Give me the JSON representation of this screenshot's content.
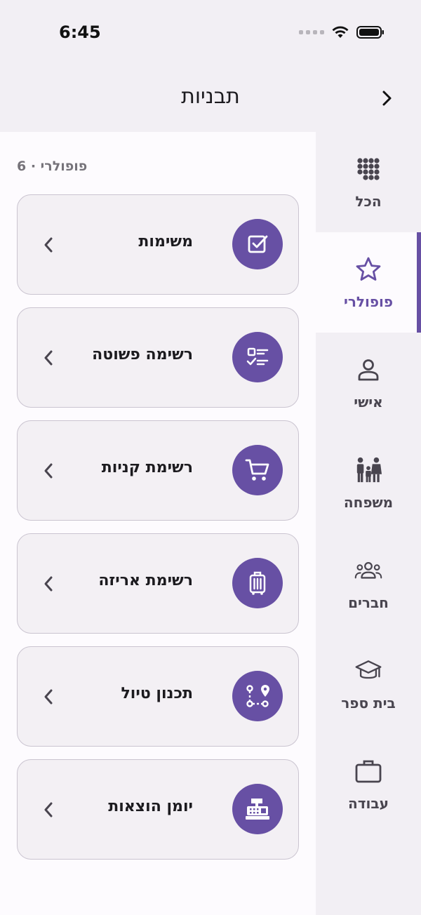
{
  "status_bar": {
    "time": "6:45"
  },
  "header": {
    "title": "תבניות"
  },
  "section": {
    "title": "6 · פופולרי"
  },
  "sidebar": {
    "items": [
      {
        "label": "הכל",
        "icon": "grid-dots-icon",
        "active": false
      },
      {
        "label": "פופולרי",
        "icon": "star-icon",
        "active": true
      },
      {
        "label": "אישי",
        "icon": "person-icon",
        "active": false
      },
      {
        "label": "משפחה",
        "icon": "family-icon",
        "active": false
      },
      {
        "label": "חברים",
        "icon": "group-icon",
        "active": false
      },
      {
        "label": "בית ספר",
        "icon": "school-icon",
        "active": false
      },
      {
        "label": "עבודה",
        "icon": "briefcase-icon",
        "active": false
      }
    ]
  },
  "templates": [
    {
      "label": "משימות",
      "icon": "checkbox-icon"
    },
    {
      "label": "רשימה פשוטה",
      "icon": "checklist-icon"
    },
    {
      "label": "רשימת קניות",
      "icon": "shopping-cart-icon"
    },
    {
      "label": "רשימת אריזה",
      "icon": "luggage-icon"
    },
    {
      "label": "תכנון טיול",
      "icon": "route-icon"
    },
    {
      "label": "יומן הוצאות",
      "icon": "cash-register-icon"
    }
  ],
  "colors": {
    "accent": "#6750a4",
    "surface": "#f2eff4",
    "card": "#f3f0f4"
  }
}
